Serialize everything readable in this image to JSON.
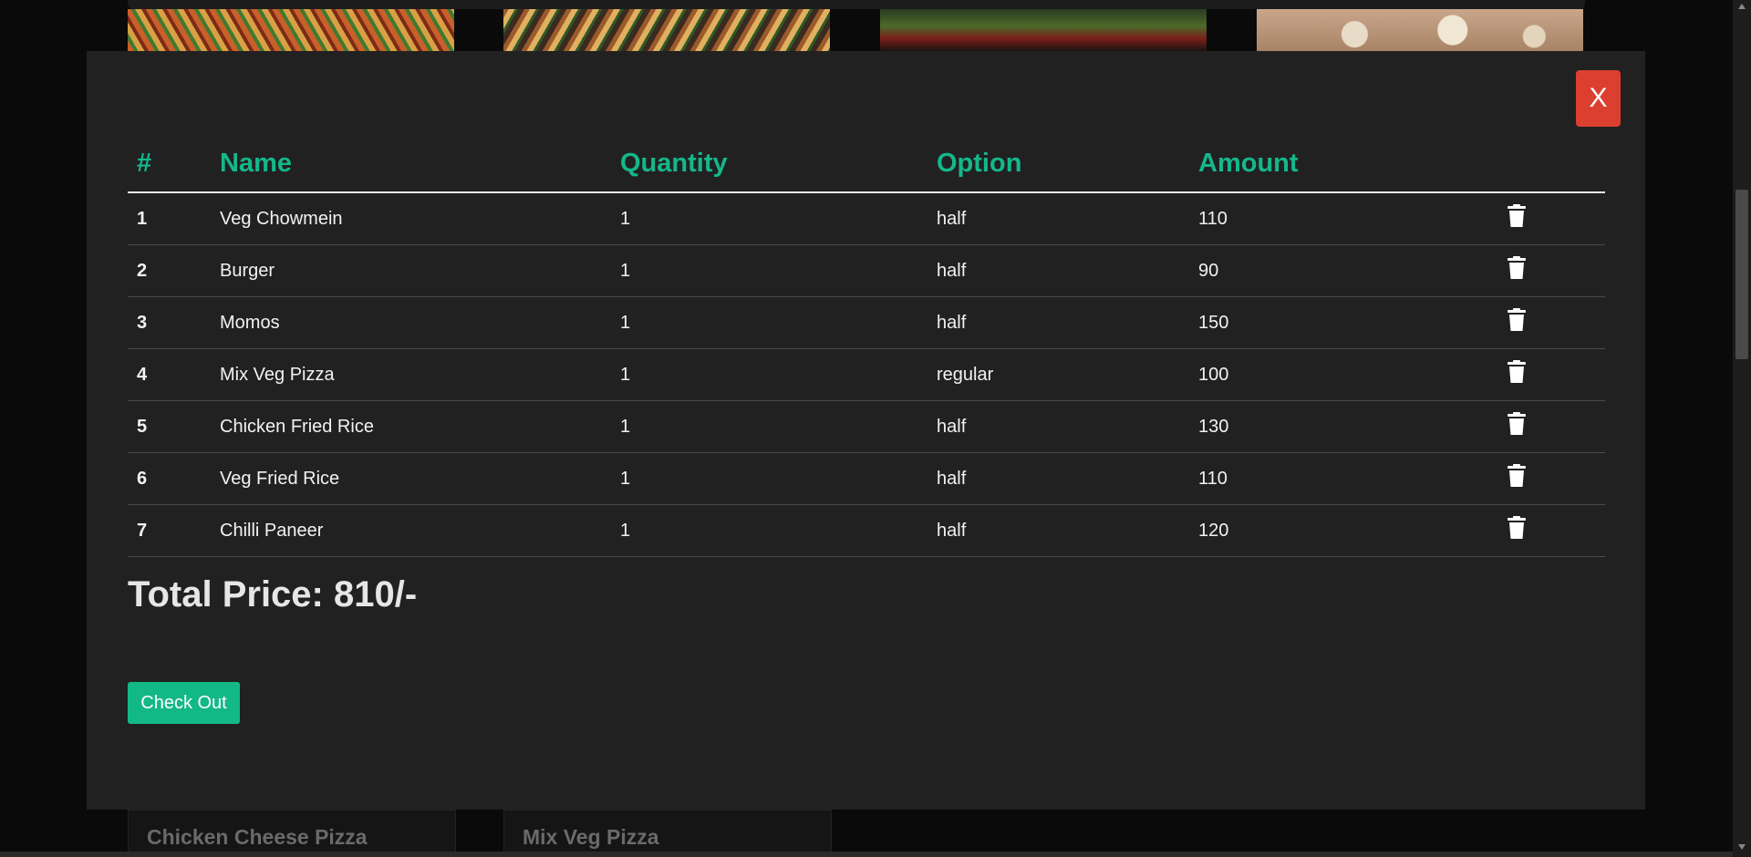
{
  "modal": {
    "close_label": "X",
    "columns": [
      "#",
      "Name",
      "Quantity",
      "Option",
      "Amount",
      ""
    ],
    "rows": [
      {
        "idx": "1",
        "name": "Veg Chowmein",
        "qty": "1",
        "option": "half",
        "amount": "110"
      },
      {
        "idx": "2",
        "name": "Burger",
        "qty": "1",
        "option": "half",
        "amount": "90"
      },
      {
        "idx": "3",
        "name": "Momos",
        "qty": "1",
        "option": "half",
        "amount": "150"
      },
      {
        "idx": "4",
        "name": "Mix Veg Pizza",
        "qty": "1",
        "option": "regular",
        "amount": "100"
      },
      {
        "idx": "5",
        "name": "Chicken Fried Rice",
        "qty": "1",
        "option": "half",
        "amount": "130"
      },
      {
        "idx": "6",
        "name": "Veg Fried Rice",
        "qty": "1",
        "option": "half",
        "amount": "110"
      },
      {
        "idx": "7",
        "name": "Chilli Paneer",
        "qty": "1",
        "option": "half",
        "amount": "120"
      }
    ],
    "total_label": "Total Price: 810/-",
    "checkout_label": "Check Out",
    "delete_icon": "trash-icon"
  },
  "background": {
    "card_titles": [
      "Chicken Cheese Pizza",
      "Mix Veg Pizza"
    ]
  },
  "colors": {
    "accent": "#14b88a",
    "close": "#dc3f30",
    "modal_bg": "#212121",
    "page_bg": "#0a0a0a"
  }
}
